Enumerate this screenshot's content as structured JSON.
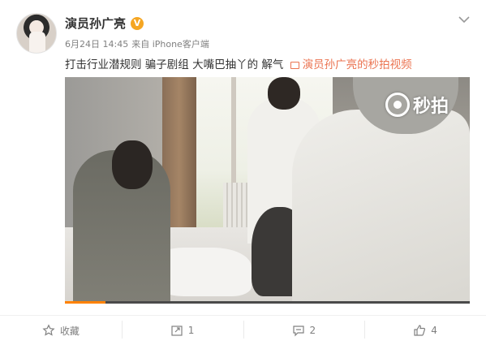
{
  "user": {
    "name": "演员孙广亮",
    "verified_badge": "V"
  },
  "meta": {
    "date": "6月24日 14:45",
    "source": "来自 iPhone客户端"
  },
  "post": {
    "text": "打击行业潜规则 骗子剧组 大嘴巴抽丫的 解气",
    "video_link": "演员孙广亮的秒拍视频"
  },
  "video": {
    "watermark": "秒拍",
    "progress": 0.1
  },
  "actions": {
    "favorite": "收藏",
    "repost": "1",
    "comment": "2",
    "like": "4"
  },
  "colors": {
    "accent": "#eb7350",
    "verified": "#f5a623",
    "progress": "#ff8200"
  },
  "icons": [
    "chevron-down-icon",
    "star-icon",
    "repost-icon",
    "comment-icon",
    "like-icon",
    "video-icon"
  ]
}
